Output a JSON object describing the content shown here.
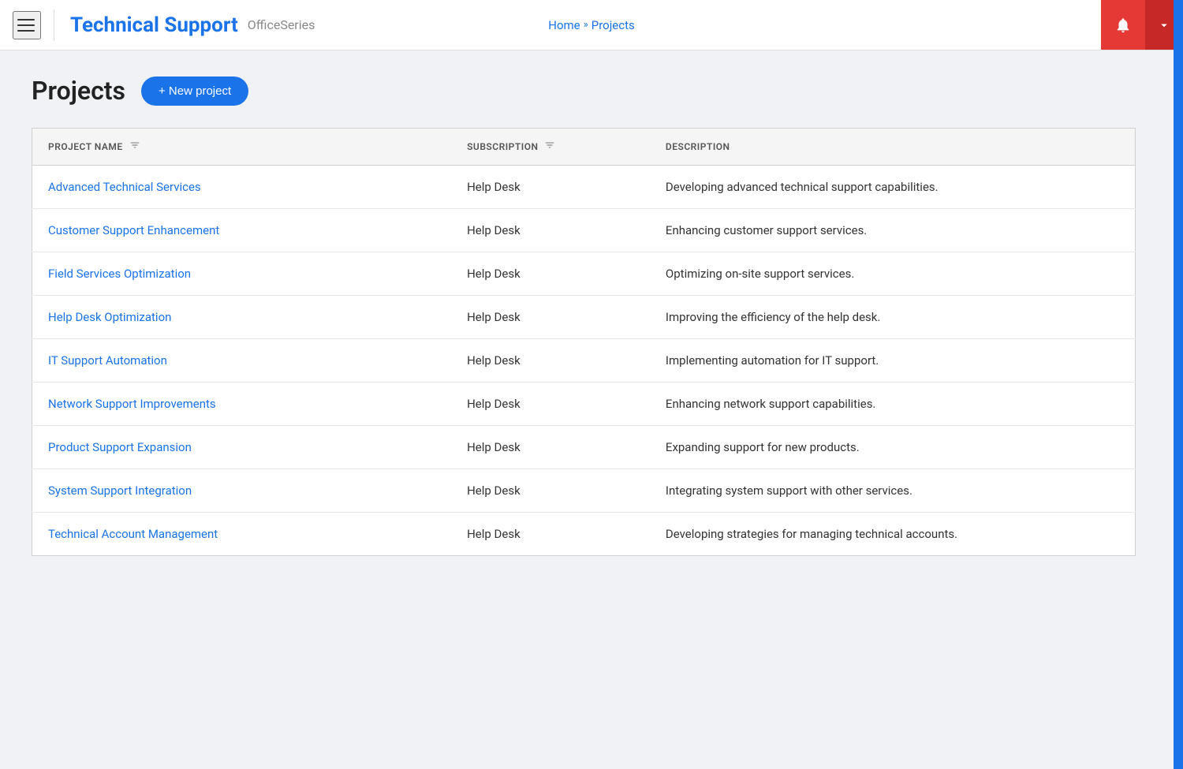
{
  "header": {
    "app_title": "Technical Support",
    "app_subtitle": "OfficeSeries",
    "breadcrumb": {
      "home": "Home",
      "separator": "»",
      "current": "Projects"
    }
  },
  "page": {
    "title": "Projects",
    "new_project_button": "+ New project"
  },
  "table": {
    "columns": {
      "project_name": "PROJECT NAME",
      "subscription": "SUBSCRIPTION",
      "description": "DESCRIPTION"
    },
    "rows": [
      {
        "name": "Advanced Technical Services",
        "subscription": "Help Desk",
        "description": "Developing advanced technical support capabilities."
      },
      {
        "name": "Customer Support Enhancement",
        "subscription": "Help Desk",
        "description": "Enhancing customer support services."
      },
      {
        "name": "Field Services Optimization",
        "subscription": "Help Desk",
        "description": "Optimizing on-site support services."
      },
      {
        "name": "Help Desk Optimization",
        "subscription": "Help Desk",
        "description": "Improving the efficiency of the help desk."
      },
      {
        "name": "IT Support Automation",
        "subscription": "Help Desk",
        "description": "Implementing automation for IT support."
      },
      {
        "name": "Network Support Improvements",
        "subscription": "Help Desk",
        "description": "Enhancing network support capabilities."
      },
      {
        "name": "Product Support Expansion",
        "subscription": "Help Desk",
        "description": "Expanding support for new products."
      },
      {
        "name": "System Support Integration",
        "subscription": "Help Desk",
        "description": "Integrating system support with other services."
      },
      {
        "name": "Technical Account Management",
        "subscription": "Help Desk",
        "description": "Developing strategies for managing technical accounts."
      }
    ]
  },
  "icons": {
    "hamburger": "☰",
    "bell": "🔔",
    "chevron_down": "▾",
    "filter": "⊿",
    "plus": "+"
  },
  "colors": {
    "primary": "#1a73e8",
    "red_dark": "#c62828",
    "red_medium": "#e53935"
  }
}
